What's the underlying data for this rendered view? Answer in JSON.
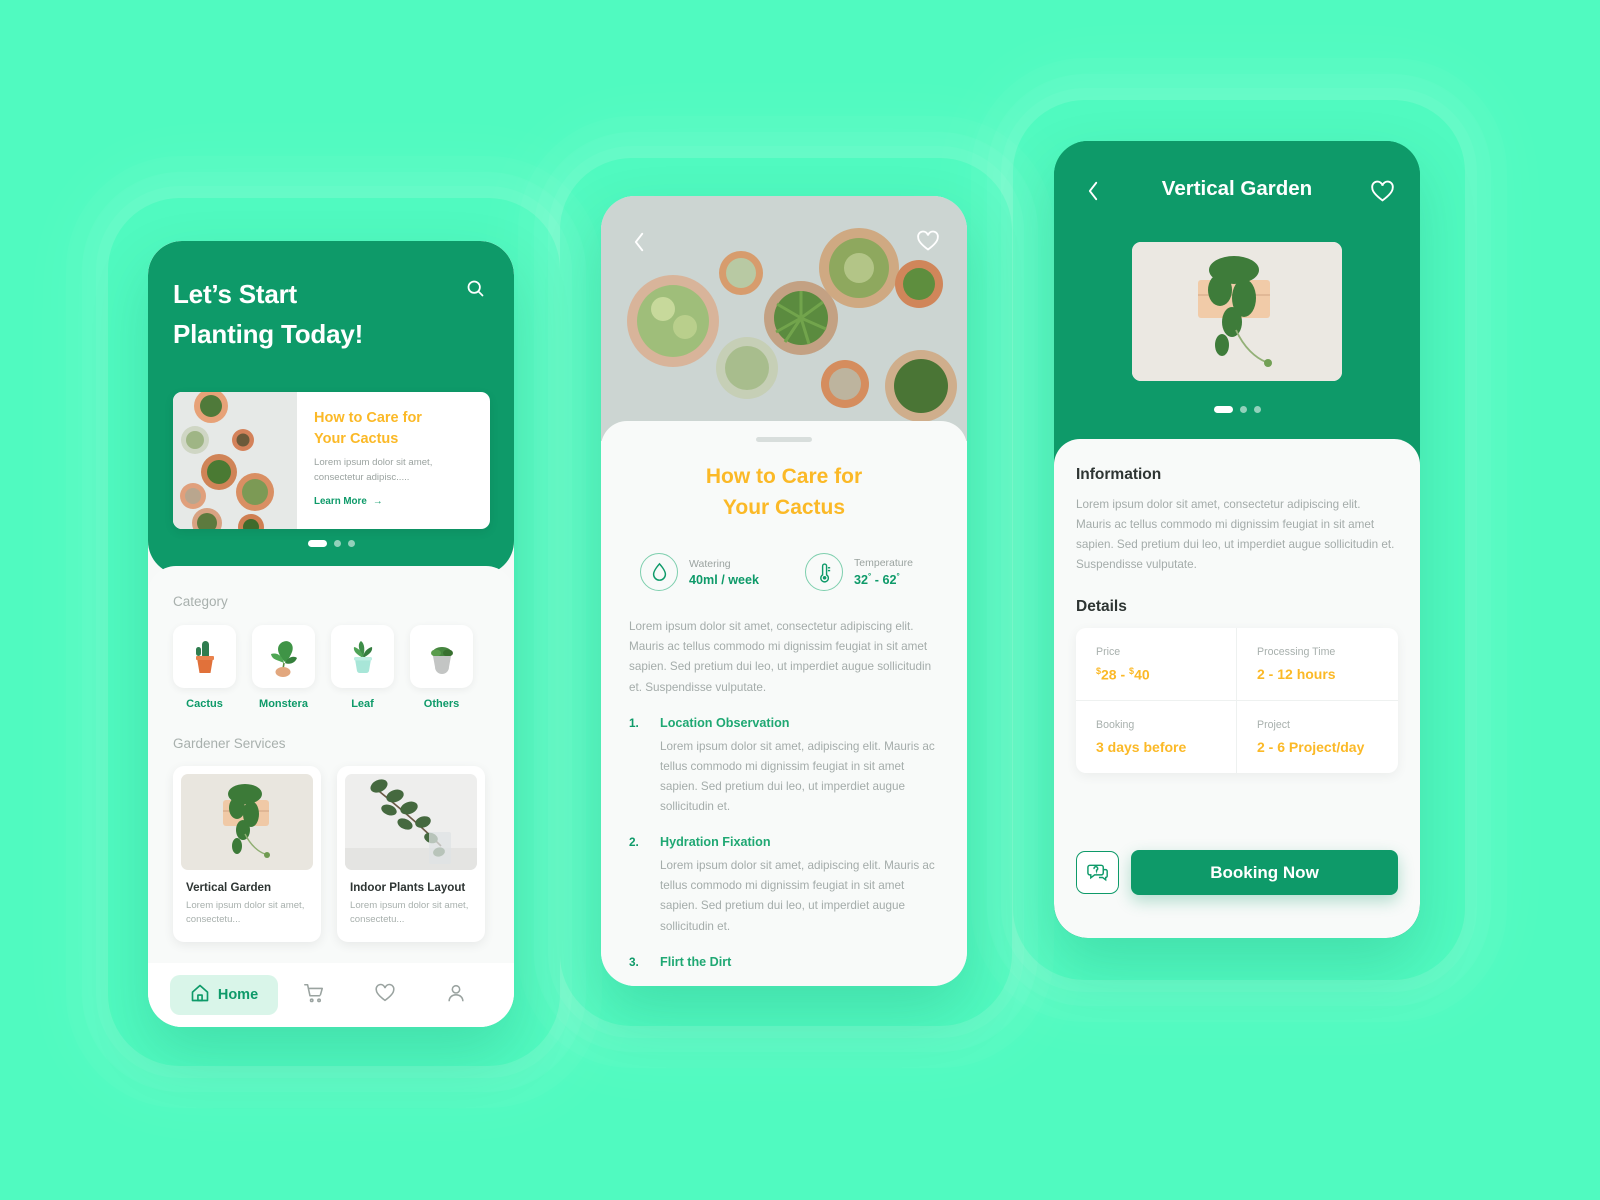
{
  "theme": {
    "background": "#50fac0",
    "primary_green": "#0e9a69",
    "accent_orange": "#fbb927",
    "muted_text": "#a8b0ad",
    "sheet_bg": "#f8faf9"
  },
  "phone1": {
    "header": {
      "title_line1": "Let’s Start",
      "title_line2": "Planting Today!",
      "search_icon": "search-icon"
    },
    "promo": {
      "heading_line1": "How to Care for",
      "heading_line2": "Your Cactus",
      "body": "Lorem ipsum dolor sit amet, consectetur adipisc.....",
      "link": "Learn More",
      "arrow": "→",
      "image_alt": "cactus-pots-top-view"
    },
    "carousel": {
      "total": 3,
      "active": 1
    },
    "category": {
      "label": "Category",
      "items": [
        {
          "name": "Cactus",
          "icon": "cactus-plant-icon"
        },
        {
          "name": "Monstera",
          "icon": "monstera-plant-icon"
        },
        {
          "name": "Leaf",
          "icon": "leaf-plant-icon"
        },
        {
          "name": "Others",
          "icon": "other-plant-icon"
        }
      ]
    },
    "services": {
      "label": "Gardener Services",
      "items": [
        {
          "title": "Vertical Garden",
          "desc": "Lorem ipsum dolor sit amet, consectetu...",
          "image_alt": "vertical-garden-wall-planter"
        },
        {
          "title": "Indoor Plants Layout",
          "desc": "Lorem ipsum dolor sit amet, consectetu...",
          "image_alt": "eucalyptus-branch-in-glass"
        }
      ]
    },
    "tabbar": [
      {
        "label": "Home",
        "icon": "home-icon",
        "active": true
      },
      {
        "label": "",
        "icon": "cart-icon",
        "active": false
      },
      {
        "label": "",
        "icon": "heart-icon",
        "active": false
      },
      {
        "label": "",
        "icon": "profile-icon",
        "active": false
      }
    ]
  },
  "phone2": {
    "hero": {
      "back_icon": "chevron-left-icon",
      "favorite_icon": "heart-outline-icon",
      "image_alt": "assorted-succulents-top-view"
    },
    "title_line1": "How to Care for",
    "title_line2": "Your Cactus",
    "stats": [
      {
        "key": "Watering",
        "value": "40ml / week",
        "icon": "water-drop-icon"
      },
      {
        "key": "Temperature",
        "value_a": "32",
        "dash": "-",
        "value_b": "62",
        "degree": "°",
        "icon": "thermometer-icon"
      }
    ],
    "intro": "Lorem ipsum dolor sit amet, consectetur adipiscing elit. Mauris ac tellus commodo mi dignissim feugiat in sit amet sapien. Sed pretium dui leo, ut imperdiet augue sollicitudin et. Suspendisse vulputate.",
    "steps": [
      {
        "num": "1.",
        "title": "Location Observation",
        "body": "Lorem ipsum dolor sit amet, adipiscing elit. Mauris ac tellus commodo mi dignissim feugiat in sit amet sapien. Sed pretium dui leo, ut imperdiet augue sollicitudin et."
      },
      {
        "num": "2.",
        "title": "Hydration Fixation",
        "body": "Lorem ipsum dolor sit amet, adipiscing elit. Mauris ac tellus commodo mi dignissim feugiat in sit amet sapien. Sed pretium dui leo, ut imperdiet augue sollicitudin et."
      },
      {
        "num": "3.",
        "title": "Flirt the Dirt",
        "body": ""
      }
    ]
  },
  "phone3": {
    "header": {
      "back_icon": "chevron-left-icon",
      "title": "Vertical Garden",
      "favorite_icon": "heart-outline-icon",
      "image_alt": "vertical-garden-wall-planter"
    },
    "carousel": {
      "total": 3,
      "active": 1
    },
    "information": {
      "heading": "Information",
      "body": "Lorem ipsum dolor sit amet, consectetur adipiscing elit. Mauris ac tellus commodo mi dignissim feugiat in sit amet sapien. Sed pretium dui leo, ut imperdiet augue sollicitudin et. Suspendisse vulputate."
    },
    "details": {
      "heading": "Details",
      "cells": [
        {
          "key": "Price",
          "currency": "$",
          "value": "28",
          "dash": "-",
          "currency2": "$",
          "value2": "40"
        },
        {
          "key": "Processing Time",
          "value": "2 - 12 hours"
        },
        {
          "key": "Booking",
          "value": "3 days before"
        },
        {
          "key": "Project",
          "value": "2 - 6 Project/day"
        }
      ]
    },
    "cta": {
      "chat_icon": "chat-question-icon",
      "book_label": "Booking Now"
    }
  }
}
